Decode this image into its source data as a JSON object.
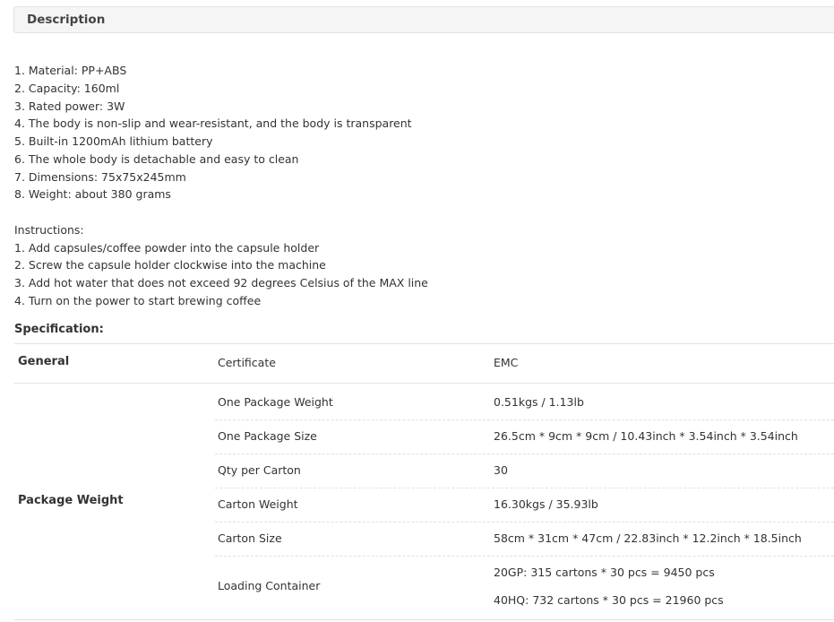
{
  "description": {
    "title": "Description",
    "features": [
      "1. Material: PP+ABS",
      "2. Capacity: 160ml",
      "3. Rated power: 3W",
      "4. The body is non-slip and wear-resistant, and the body is transparent",
      "5. Built-in 1200mAh lithium battery",
      "6. The whole body is detachable and easy to clean",
      "7. Dimensions: 75x75x245mm",
      "8. Weight: about 380 grams"
    ],
    "instructions_heading": "Instructions:",
    "instructions": [
      "1. Add capsules/coffee powder into the capsule holder",
      "2. Screw the capsule holder clockwise into the machine",
      "3. Add hot water that does not exceed 92 degrees Celsius of the MAX line",
      "4. Turn on the power to start brewing coffee"
    ]
  },
  "specification": {
    "title": "Specification:",
    "general": {
      "group": "General",
      "label": "Certificate",
      "value": "EMC"
    },
    "package": {
      "group": "Package Weight",
      "rows": [
        {
          "label": "One Package Weight",
          "value": "0.51kgs / 1.13lb"
        },
        {
          "label": "One Package Size",
          "value": "26.5cm * 9cm * 9cm / 10.43inch * 3.54inch * 3.54inch"
        },
        {
          "label": "Qty per Carton",
          "value": "30"
        },
        {
          "label": "Carton Weight",
          "value": "16.30kgs / 35.93lb"
        },
        {
          "label": "Carton Size",
          "value": "58cm * 31cm * 47cm / 22.83inch * 12.2inch * 18.5inch"
        },
        {
          "label": "Loading Container",
          "values": [
            "20GP: 315 cartons * 30 pcs = 9450 pcs",
            "40HQ: 732 cartons * 30 pcs = 21960 pcs"
          ]
        }
      ]
    }
  }
}
